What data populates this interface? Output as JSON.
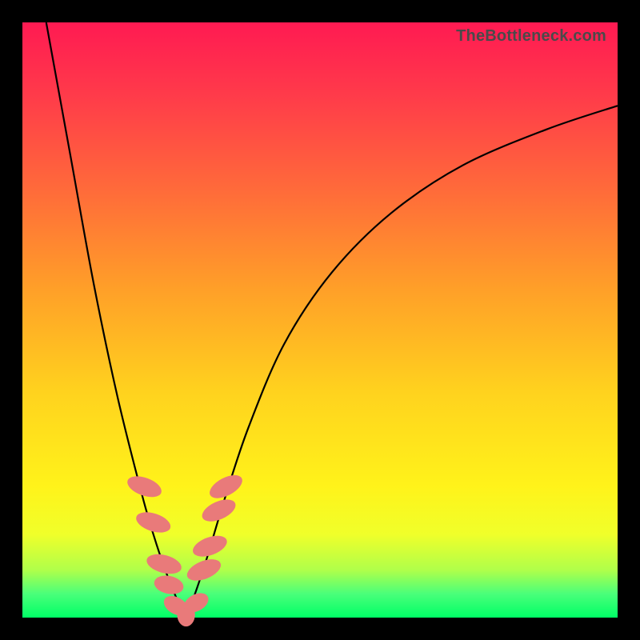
{
  "watermark": "TheBottleneck.com",
  "colors": {
    "frame": "#000000",
    "gradient_top": "#ff1a52",
    "gradient_bottom": "#00ff66",
    "curve": "#000000",
    "bead": "#e97a7a"
  },
  "chart_data": {
    "type": "line",
    "title": "",
    "xlabel": "",
    "ylabel": "",
    "xlim": [
      0,
      100
    ],
    "ylim": [
      0,
      100
    ],
    "grid": false,
    "legend": false,
    "series": [
      {
        "name": "left-curve",
        "x": [
          4,
          8,
          12,
          16,
          20,
          22,
          24,
          26,
          27,
          27.5
        ],
        "y": [
          100,
          78,
          56,
          37,
          21,
          14,
          8,
          3,
          1,
          0
        ]
      },
      {
        "name": "right-curve",
        "x": [
          27.5,
          29,
          31,
          34,
          38,
          44,
          52,
          62,
          74,
          88,
          100
        ],
        "y": [
          0,
          4,
          10,
          20,
          32,
          46,
          58,
          68,
          76,
          82,
          86
        ]
      }
    ],
    "beads": [
      {
        "x": 20.5,
        "y": 22,
        "rx": 1.5,
        "ry": 3.0,
        "angle": -70
      },
      {
        "x": 22.0,
        "y": 16,
        "rx": 1.5,
        "ry": 3.0,
        "angle": -72
      },
      {
        "x": 23.8,
        "y": 9,
        "rx": 1.5,
        "ry": 3.0,
        "angle": -75
      },
      {
        "x": 24.6,
        "y": 5.5,
        "rx": 1.5,
        "ry": 2.5,
        "angle": -78
      },
      {
        "x": 25.8,
        "y": 2.0,
        "rx": 1.4,
        "ry": 2.2,
        "angle": -60
      },
      {
        "x": 27.5,
        "y": 0.5,
        "rx": 1.5,
        "ry": 2.0,
        "angle": 0
      },
      {
        "x": 29.2,
        "y": 2.5,
        "rx": 1.4,
        "ry": 2.2,
        "angle": 62
      },
      {
        "x": 30.5,
        "y": 8,
        "rx": 1.5,
        "ry": 3.0,
        "angle": 68
      },
      {
        "x": 31.5,
        "y": 12,
        "rx": 1.5,
        "ry": 3.0,
        "angle": 70
      },
      {
        "x": 33.0,
        "y": 18,
        "rx": 1.5,
        "ry": 3.0,
        "angle": 66
      },
      {
        "x": 34.2,
        "y": 22,
        "rx": 1.5,
        "ry": 3.0,
        "angle": 62
      }
    ]
  }
}
